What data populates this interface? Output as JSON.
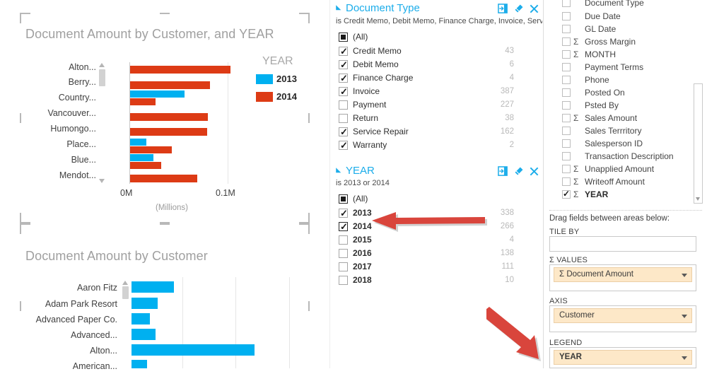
{
  "colors": {
    "series_2013": "#00B0F0",
    "series_2014": "#DD3B15",
    "accent": "#1CADEA",
    "arrow": "#D9453C",
    "pill_bg": "#FDE8C8"
  },
  "charts": {
    "top": {
      "title": "Document Amount by Customer, and YEAR",
      "axis_unit": "(Millions)",
      "legend_title": "YEAR",
      "x_ticks": [
        "0M",
        "0.1M"
      ],
      "legend": [
        {
          "label": "2013",
          "color": "#00B0F0"
        },
        {
          "label": "2014",
          "color": "#DD3B15"
        }
      ]
    },
    "bottom": {
      "title": "Document Amount by Customer"
    }
  },
  "chart_data": [
    {
      "type": "bar",
      "orientation": "horizontal",
      "title": "Document Amount by Customer, and YEAR",
      "xlabel": "(Millions)",
      "ylabel": "",
      "xlim": [
        0,
        0.145
      ],
      "xticks": [
        0,
        0.1
      ],
      "xticklabels": [
        "0M",
        "0.1M"
      ],
      "grid": true,
      "legend": "right",
      "legend_title": "YEAR",
      "categories": [
        "Alton...",
        "Berry...",
        "Country...",
        "Vancouver...",
        "Humongo...",
        "Place...",
        "Blue...",
        "Mendot..."
      ],
      "series": [
        {
          "name": "2013",
          "color": "#00B0F0",
          "values": [
            0,
            0,
            0.0405,
            0,
            0,
            0.0155,
            0.0225,
            0
          ]
        },
        {
          "name": "2014",
          "color": "#DD3B15",
          "values": [
            0.1025,
            0.0815,
            0.0185,
            0.0795,
            0.0785,
            0.0415,
            0.0285,
            0.0705
          ]
        }
      ]
    },
    {
      "type": "bar",
      "orientation": "horizontal",
      "title": "Document Amount by Customer",
      "xlabel": "",
      "ylabel": "",
      "grid": true,
      "xlim": [
        0,
        0.28
      ],
      "categories": [
        "Aaron Fitz",
        "Adam Park Resort",
        "Advanced Paper Co.",
        "Advanced...",
        "Alton...",
        "American..."
      ],
      "series": [
        {
          "name": "Document Amount",
          "color": "#00B0F0",
          "values": [
            0.066,
            0.04,
            0.029,
            0.037,
            0.18,
            0.024
          ]
        }
      ]
    }
  ],
  "filters": [
    {
      "title": "Document Type",
      "subtitle": "is Credit Memo, Debit Memo, Finance Charge, Invoice, Service",
      "icons": [
        "popout-icon",
        "eraser-icon",
        "close-icon"
      ],
      "items": [
        {
          "label": "(All)",
          "count": "",
          "state": "partial"
        },
        {
          "label": "Credit Memo",
          "count": "43",
          "state": "checked"
        },
        {
          "label": "Debit Memo",
          "count": "6",
          "state": "checked"
        },
        {
          "label": "Finance Charge",
          "count": "4",
          "state": "checked"
        },
        {
          "label": "Invoice",
          "count": "387",
          "state": "checked"
        },
        {
          "label": "Payment",
          "count": "227",
          "state": "unchecked"
        },
        {
          "label": "Return",
          "count": "38",
          "state": "unchecked"
        },
        {
          "label": "Service Repair",
          "count": "162",
          "state": "checked"
        },
        {
          "label": "Warranty",
          "count": "2",
          "state": "checked"
        }
      ]
    },
    {
      "title": "YEAR",
      "subtitle": "is 2013 or 2014",
      "icons": [
        "popout-icon",
        "eraser-icon",
        "close-icon"
      ],
      "items": [
        {
          "label": "(All)",
          "count": "",
          "state": "partial"
        },
        {
          "label": "2013",
          "count": "338",
          "state": "checked"
        },
        {
          "label": "2014",
          "count": "266",
          "state": "checked-focus"
        },
        {
          "label": "2015",
          "count": "4",
          "state": "unchecked"
        },
        {
          "label": "2016",
          "count": "138",
          "state": "unchecked"
        },
        {
          "label": "2017",
          "count": "111",
          "state": "unchecked"
        },
        {
          "label": "2018",
          "count": "10",
          "state": "unchecked"
        }
      ]
    }
  ],
  "field_list": [
    {
      "label": "Document Type",
      "sigma": false,
      "checked": false
    },
    {
      "label": "Due Date",
      "sigma": false,
      "checked": false
    },
    {
      "label": "GL Date",
      "sigma": false,
      "checked": false
    },
    {
      "label": "Gross Margin",
      "sigma": true,
      "checked": false
    },
    {
      "label": "MONTH",
      "sigma": true,
      "checked": false
    },
    {
      "label": "Payment Terms",
      "sigma": false,
      "checked": false
    },
    {
      "label": "Phone",
      "sigma": false,
      "checked": false
    },
    {
      "label": "Posted On",
      "sigma": false,
      "checked": false
    },
    {
      "label": "Psted By",
      "sigma": false,
      "checked": false
    },
    {
      "label": "Sales Amount",
      "sigma": true,
      "checked": false
    },
    {
      "label": "Sales Terrritory",
      "sigma": false,
      "checked": false
    },
    {
      "label": "Salesperson ID",
      "sigma": false,
      "checked": false
    },
    {
      "label": "Transaction Description",
      "sigma": false,
      "checked": false
    },
    {
      "label": "Unapplied Amount",
      "sigma": true,
      "checked": false
    },
    {
      "label": "Writeoff Amount",
      "sigma": true,
      "checked": false
    },
    {
      "label": "YEAR",
      "sigma": true,
      "checked": true
    }
  ],
  "wells": {
    "hint": "Drag fields between areas below:",
    "tile_by": {
      "label": "TILE BY",
      "value": ""
    },
    "values": {
      "label": "VALUES",
      "sigma": true,
      "value": "Document Amount",
      "value_sigma": true
    },
    "axis": {
      "label": "AXIS",
      "value": "Customer"
    },
    "legend": {
      "label": "LEGEND",
      "value": "YEAR"
    }
  }
}
